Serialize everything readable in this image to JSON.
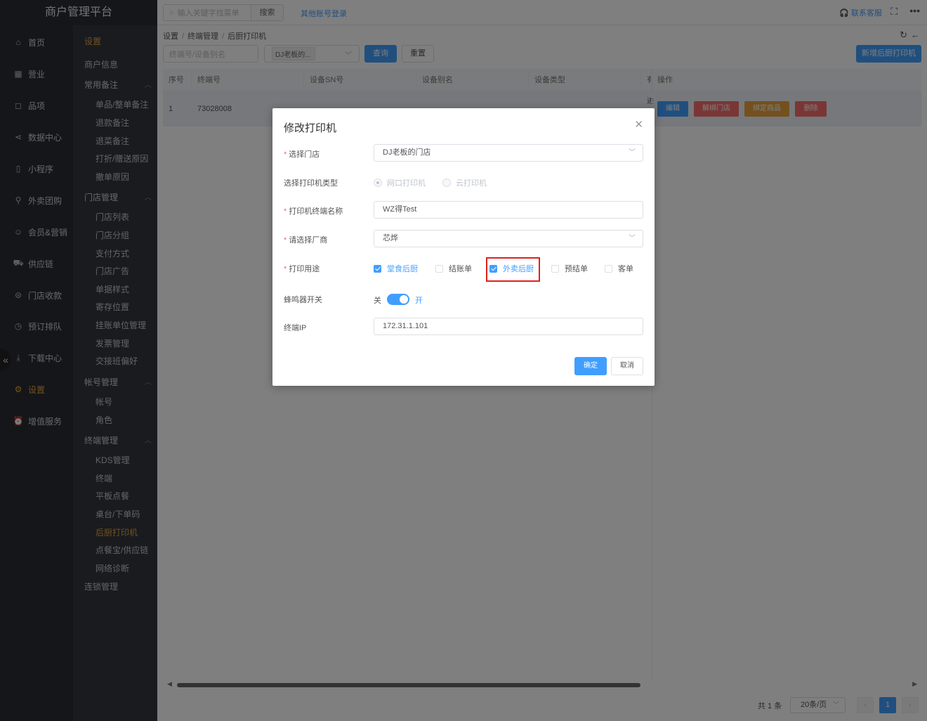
{
  "app": {
    "title": "商户管理平台"
  },
  "topbar": {
    "search_placeholder": "输入关键字找菜单",
    "search_button": "搜索",
    "other_login": "其他账号登录",
    "contact": "联系客服"
  },
  "nav_primary": [
    {
      "label": "首页",
      "icon": "home-icon"
    },
    {
      "label": "营业",
      "icon": "calendar-icon"
    },
    {
      "label": "品项",
      "icon": "bag-icon"
    },
    {
      "label": "数据中心",
      "icon": "share-icon"
    },
    {
      "label": "小程序",
      "icon": "phone-icon"
    },
    {
      "label": "外卖团购",
      "icon": "bike-icon"
    },
    {
      "label": "会员&营销",
      "icon": "user-icon"
    },
    {
      "label": "供应链",
      "icon": "truck-icon"
    },
    {
      "label": "门店收款",
      "icon": "coins-icon"
    },
    {
      "label": "预订排队",
      "icon": "clock-icon"
    },
    {
      "label": "下载中心",
      "icon": "download-icon"
    },
    {
      "label": "设置",
      "icon": "gear-icon",
      "active": true
    },
    {
      "label": "增值服务",
      "icon": "alarm-icon"
    }
  ],
  "nav_secondary": {
    "title": "设置",
    "shop_info": "商户信息",
    "groups": [
      {
        "label": "常用备注",
        "items": [
          "单品/整单备注",
          "退款备注",
          "退菜备注",
          "打折/赠送原因",
          "撤单原因"
        ]
      },
      {
        "label": "门店管理",
        "items": [
          "门店列表",
          "门店分组",
          "支付方式",
          "门店广告",
          "单据样式",
          "寄存位置",
          "挂账单位管理",
          "发票管理",
          "交接班偏好"
        ]
      },
      {
        "label": "帐号管理",
        "items": [
          "帐号",
          "角色"
        ]
      },
      {
        "label": "终端管理",
        "items": [
          "KDS管理",
          "终端",
          "平板点餐",
          "桌台/下单码",
          "后厨打印机",
          "点餐宝/供应链",
          "网络诊断"
        ]
      }
    ],
    "chain": "连锁管理",
    "active_item": "后厨打印机"
  },
  "breadcrumb": [
    "设置",
    "终端管理",
    "后厨打印机"
  ],
  "filters": {
    "terminal_placeholder": "终端号/设备别名",
    "store_tag": "DJ老板的...",
    "query": "查询",
    "reset": "重置",
    "add": "新增后厨打印机"
  },
  "table": {
    "columns": [
      "序号",
      "终端号",
      "设备SN号",
      "设备别名",
      "设备类型",
      "有",
      "操作"
    ],
    "rows": [
      {
        "index": "1",
        "terminal": "73028008",
        "ops": [
          "编辑",
          "解绑门店",
          "绑定商品",
          "删除"
        ]
      }
    ],
    "cut_marker": "进"
  },
  "pagination": {
    "total": "共 1 条",
    "page_size": "20条/页",
    "current": "1"
  },
  "dialog": {
    "title": "修改打印机",
    "store_label": "选择门店",
    "store_value": "DJ老板的门店",
    "type_label": "选择打印机类型",
    "type_options": [
      "网口打印机",
      "云打印机"
    ],
    "name_label": "打印机终端名称",
    "name_value": "WZ得Test",
    "vendor_label": "请选择厂商",
    "vendor_value": "芯烨",
    "usage_label": "打印用途",
    "usage_options": [
      {
        "label": "堂食后厨",
        "checked": true
      },
      {
        "label": "结账单",
        "checked": false
      },
      {
        "label": "外卖后厨",
        "checked": true
      },
      {
        "label": "预结单",
        "checked": false
      },
      {
        "label": "客单",
        "checked": false
      }
    ],
    "buzzer_label": "蜂鸣器开关",
    "buzzer_off": "关",
    "buzzer_on": "开",
    "ip_label": "终端IP",
    "ip_value": "172.31.1.101",
    "ok": "确定",
    "cancel": "取消"
  },
  "colors": {
    "primary": "#409eff",
    "danger": "#f56c6c",
    "warning": "#e6a23c",
    "highlight": "#e02020",
    "nav_bg": "#2a2d33"
  }
}
